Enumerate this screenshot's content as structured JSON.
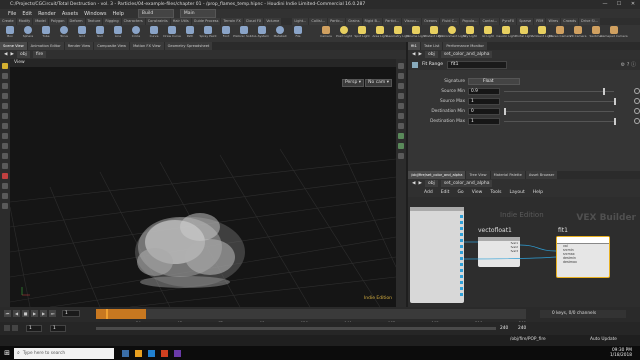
{
  "window": {
    "title": "C:/Projects/CGCircuit/Total Destruction - vol. 3 - Particles/04-example-files/chapter 01 - /prop_flames_temp.hipnc - Houdini Indie Limited-Commercial 16.0.287",
    "min": "—",
    "max": "☐",
    "close": "✕"
  },
  "menubar": {
    "items": [
      "File",
      "Edit",
      "Render",
      "Assets",
      "Windows",
      "Help"
    ],
    "build": "Build",
    "main": "Main"
  },
  "shelf_tabs": [
    "Create",
    "Modify",
    "Model",
    "Polygon",
    "Deform",
    "Texture",
    "Rigging",
    "Characters",
    "Constraints",
    "Hair Utils",
    "Guide Process",
    "Terrain FX",
    "Cloud FX",
    "Volume"
  ],
  "shelf_tools": [
    "Box",
    "Sphere",
    "Tube",
    "Torus",
    "Grid",
    "Null",
    "Line",
    "Circle",
    "Curve",
    "Draw Curve",
    "Path",
    "Spray Paint",
    "Font",
    "Platonic Solids",
    "L-System",
    "Metaball",
    "File"
  ],
  "shelf_tabs2": [
    "Light...",
    "Collisi...",
    "Partic...",
    "Grains",
    "Rigid B...",
    "Particl...",
    "Viscou...",
    "Oceans",
    "Fluid C...",
    "Popula...",
    "Contai...",
    "PyroFX",
    "Sparse",
    "FEM",
    "Wires",
    "Crowds",
    "Drive Si..."
  ],
  "light_tools": [
    "Camera",
    "Point Light",
    "Spot Light",
    "Area Light",
    "Geometry Light",
    "Volume Light",
    "Distant Light",
    "Environment Light",
    "Sky Light",
    "GI Light",
    "Caustic Light",
    "Portal Light",
    "Ambient Light",
    "Stereo Camera",
    "VR Camera",
    "Switcher",
    "Gamepad Camera"
  ],
  "left_tabs": [
    "Scene View",
    "Animation Editor",
    "Render View",
    "Composite View",
    "Motion FX View",
    "Geometry Spreadsheet"
  ],
  "viewport": {
    "path": [
      "obj",
      "fire"
    ],
    "label": "View",
    "persp": "Persp ▾",
    "cam": "No cam ▾",
    "watermark": "Indie Edition"
  },
  "parm_tabs": [
    "fit1",
    "Take List",
    "Performance Monitor"
  ],
  "parm_path": [
    "obj",
    "set_color_and_alpha"
  ],
  "node": {
    "type": "Fit Range",
    "name": "fit1",
    "signature_label": "Signature",
    "signature_value": "Float",
    "parms": [
      {
        "label": "Source Min",
        "value": "0.9",
        "slider": 0.9
      },
      {
        "label": "Source Max",
        "value": "1",
        "slider": 1.0
      },
      {
        "label": "Destination Min",
        "value": "0",
        "slider": 0.0
      },
      {
        "label": "Destination Max",
        "value": "1",
        "slider": 1.0
      }
    ]
  },
  "net_tabs": [
    "/obj/fire/set_color_and_alpha",
    "Tree View",
    "Material Palette",
    "Asset Browser"
  ],
  "net_path": [
    "obj",
    "set_color_and_alpha"
  ],
  "net_menu": [
    "Add",
    "Edit",
    "Go",
    "View",
    "Tools",
    "Layout",
    "Help"
  ],
  "network": {
    "watermark1": "Indie Edition",
    "watermark2": "VEX Builder",
    "node1": "vectofloat1",
    "node2": "fit1",
    "node2_inputs": [
      "val",
      "srcmin",
      "srcmax",
      "destmin",
      "destmax"
    ],
    "node1_outputs": [
      "fval1",
      "fval2",
      "fval3"
    ]
  },
  "timeline": {
    "ticks": [
      "24",
      "48",
      "72",
      "96",
      "120",
      "144",
      "168",
      "192",
      "216",
      "240"
    ],
    "current_frame": "1",
    "start": "1",
    "end": "240",
    "end2": "240",
    "start_field": "1",
    "keys_label": "0 keys, 0/0 channels",
    "all_channels": "Key All Channels",
    "auto_update": "Auto Update",
    "status_path": "/obj/fire/POP_fire"
  },
  "taskbar": {
    "search_placeholder": "Type here to search",
    "time": "09:30 PM",
    "date": "1/18/2018"
  }
}
